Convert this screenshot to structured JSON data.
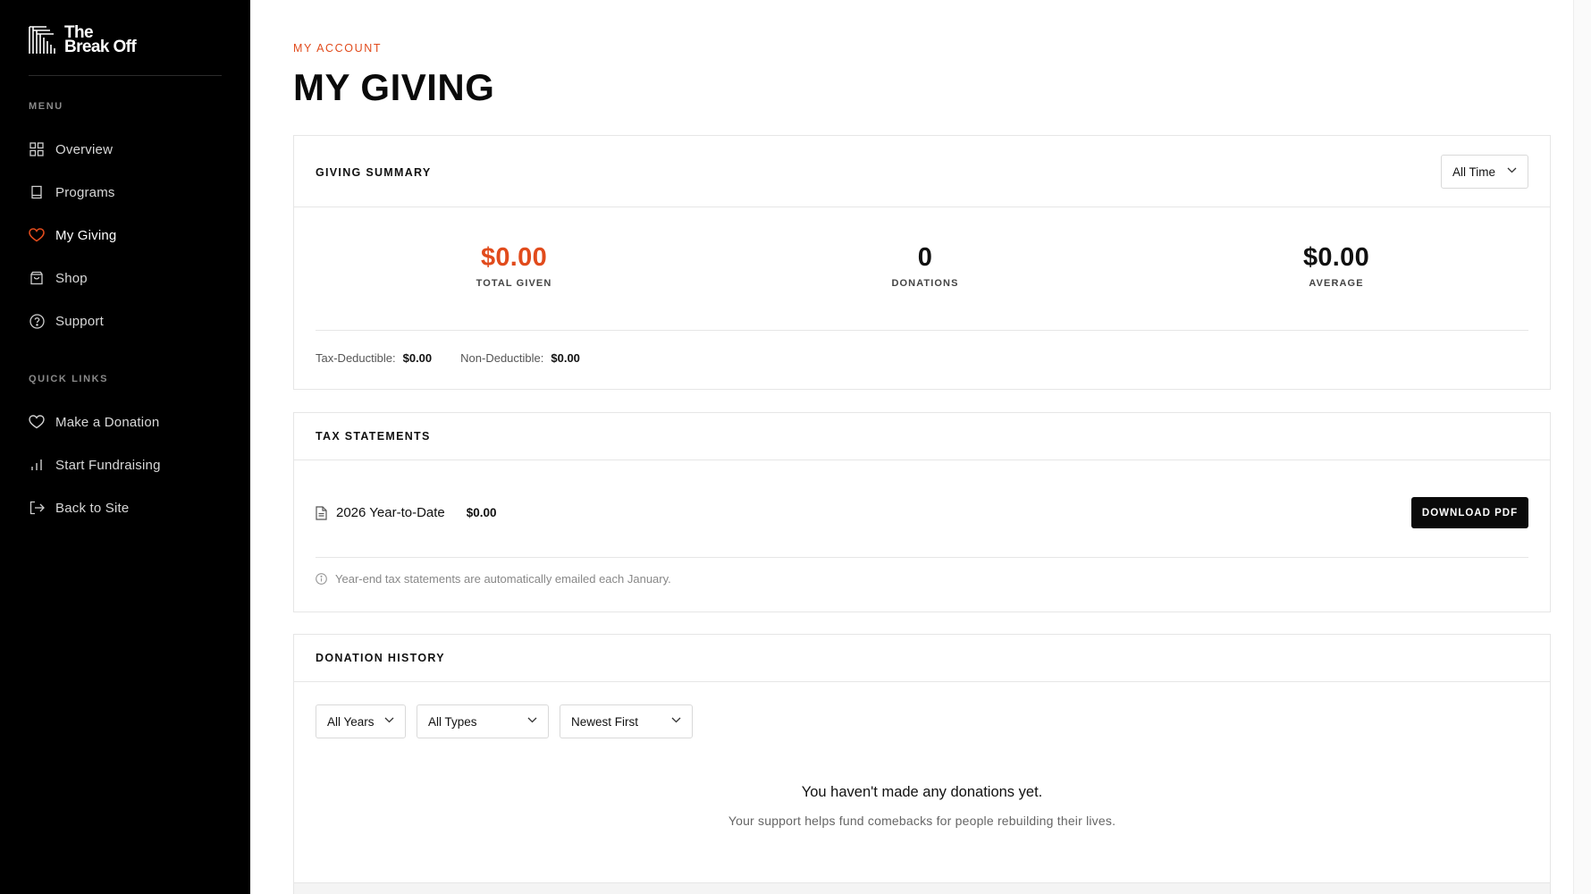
{
  "brand": {
    "line1": "The",
    "line2": "Break Off"
  },
  "sidebar": {
    "menu_heading": "MENU",
    "menu_items": [
      {
        "label": "Overview",
        "icon": "grid-icon"
      },
      {
        "label": "Programs",
        "icon": "book-icon"
      },
      {
        "label": "My Giving",
        "icon": "heart-icon",
        "active": true
      },
      {
        "label": "Shop",
        "icon": "shopping-bag-icon"
      },
      {
        "label": "Support",
        "icon": "help-circle-icon"
      }
    ],
    "quick_heading": "QUICK LINKS",
    "quick_items": [
      {
        "label": "Make a Donation",
        "icon": "heart-outline-icon"
      },
      {
        "label": "Start Fundraising",
        "icon": "bar-chart-icon"
      },
      {
        "label": "Back to Site",
        "icon": "log-out-icon"
      }
    ]
  },
  "header": {
    "eyebrow": "MY ACCOUNT",
    "title": "MY GIVING"
  },
  "summary": {
    "title": "GIVING SUMMARY",
    "period": "All Time",
    "total_given": "$0.00",
    "total_given_label": "TOTAL GIVEN",
    "donations": "0",
    "donations_label": "DONATIONS",
    "average": "$0.00",
    "average_label": "AVERAGE",
    "tax_deductible_label": "Tax-Deductible:",
    "tax_deductible_value": "$0.00",
    "non_deductible_label": "Non-Deductible:",
    "non_deductible_value": "$0.00"
  },
  "tax": {
    "title": "TAX STATEMENTS",
    "statement_name": "2026 Year-to-Date",
    "statement_amount": "$0.00",
    "download_label": "DOWNLOAD PDF",
    "note": "Year-end tax statements are automatically emailed each January."
  },
  "history": {
    "title": "DONATION HISTORY",
    "filter_year": "All Years",
    "filter_type": "All Types",
    "sort": "Newest First",
    "empty_title": "You haven't made any donations yet.",
    "empty_sub": "Your support helps fund comebacks for people rebuilding their lives."
  },
  "colors": {
    "accent": "#e14b1c",
    "sidebar_bg": "#000000",
    "border": "#e6e6e6"
  }
}
